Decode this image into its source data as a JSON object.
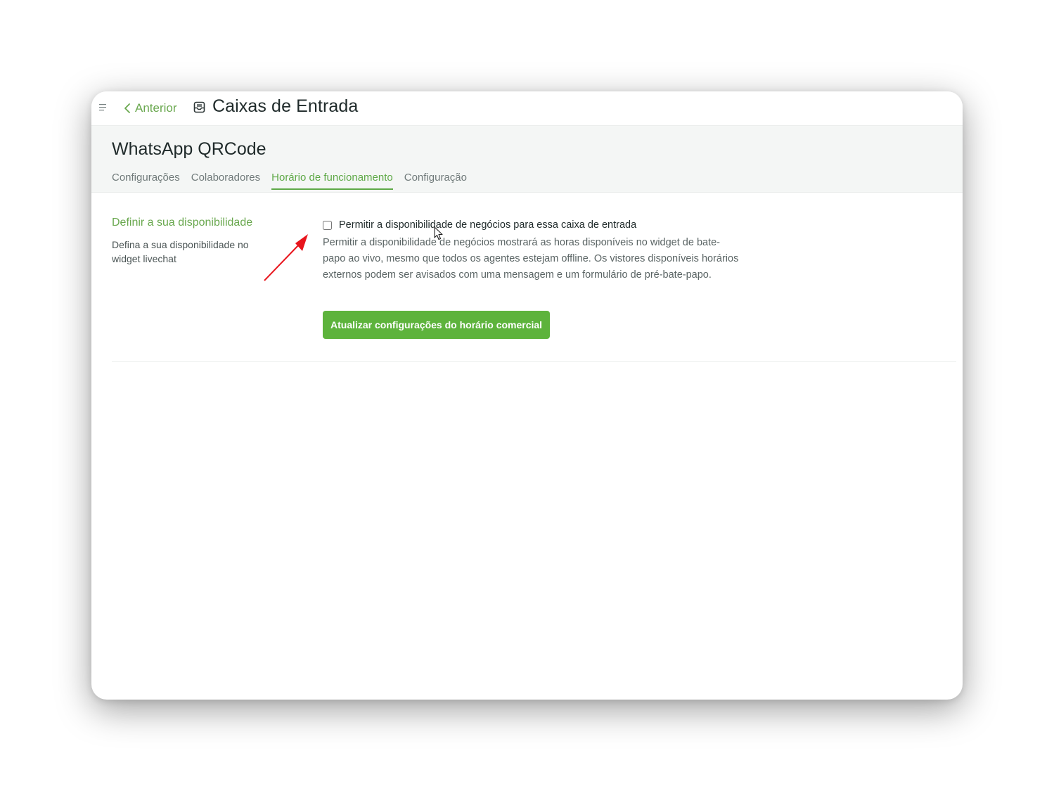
{
  "topbar": {
    "menu_icon": "hamburger-menu-icon",
    "back_label": "Anterior",
    "back_icon": "chevron-left-icon",
    "title_icon": "inbox-icon",
    "title": "Caixas de Entrada"
  },
  "inbox": {
    "name": "WhatsApp QRCode",
    "tabs": [
      {
        "label": "Configurações",
        "active": false
      },
      {
        "label": "Colaboradores",
        "active": false
      },
      {
        "label": "Horário de funcionamento",
        "active": true
      },
      {
        "label": "Configuração",
        "active": false
      }
    ]
  },
  "availability": {
    "heading": "Definir a sua disponibilidade",
    "description": "Defina a sua disponibilidade no widget livechat",
    "checkbox_label": "Permitir a disponibilidade de negócios para essa caixa de entrada",
    "checkbox_checked": false,
    "help_text": "Permitir a disponibilidade de negócios mostrará as horas disponíveis no widget de bate-papo ao vivo, mesmo que todos os agentes estejam offline. Os vistores disponíveis horários externos podem ser avisados com uma mensagem e um formulário de pré-bate-papo.",
    "update_button": "Atualizar configurações do horário comercial"
  },
  "colors": {
    "accent": "#5ea947",
    "button": "#5db33c",
    "annotation_arrow": "#e8141c"
  }
}
